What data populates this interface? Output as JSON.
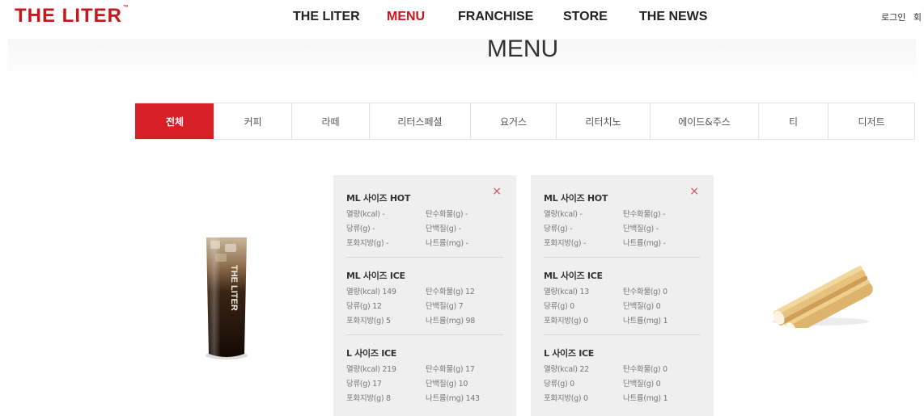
{
  "brand": {
    "logo": "THE LITER",
    "mark": "™"
  },
  "nav": {
    "items": [
      "THE LITER",
      "MENU",
      "FRANCHISE",
      "STORE",
      "THE NEWS"
    ],
    "active": "MENU"
  },
  "util": {
    "login": "로그인",
    "clipped": "회"
  },
  "page_title": "MENU",
  "tabs": {
    "items": [
      "전체",
      "커피",
      "라떼",
      "리터스페셜",
      "요거스",
      "리터치노",
      "에이드&주스",
      "티",
      "디저트"
    ],
    "active": "전체"
  },
  "panels": [
    {
      "close": "×",
      "sections": [
        {
          "title": "ML 사이즈 HOT",
          "rows": [
            [
              "열량(kcal) -",
              "탄수화물(g) -"
            ],
            [
              "당류(g) -",
              "단백질(g) -"
            ],
            [
              "포화지방(g) -",
              "나트륨(mg) -"
            ]
          ]
        },
        {
          "title": "ML 사이즈 ICE",
          "rows": [
            [
              "열량(kcal) 149",
              "탄수화물(g) 12"
            ],
            [
              "당류(g) 12",
              "단백질(g) 7"
            ],
            [
              "포화지방(g) 5",
              "나트륨(mg) 98"
            ]
          ]
        },
        {
          "title": "L 사이즈 ICE",
          "rows": [
            [
              "열량(kcal) 219",
              "탄수화물(g) 17"
            ],
            [
              "당류(g) 17",
              "단백질(g) 10"
            ],
            [
              "포화지방(g) 8",
              "나트륨(mg) 143"
            ]
          ]
        }
      ]
    },
    {
      "close": "×",
      "sections": [
        {
          "title": "ML 사이즈 HOT",
          "rows": [
            [
              "열량(kcal) -",
              "탄수화물(g) -"
            ],
            [
              "당류(g) -",
              "단백질(g) -"
            ],
            [
              "포화지방(g) -",
              "나트륨(mg) -"
            ]
          ]
        },
        {
          "title": "ML 사이즈 ICE",
          "rows": [
            [
              "열량(kcal) 13",
              "탄수화물(g) 0"
            ],
            [
              "당류(g) 0",
              "단백질(g) 0"
            ],
            [
              "포화지방(g) 0",
              "나트륨(mg) 1"
            ]
          ]
        },
        {
          "title": "L 사이즈 ICE",
          "rows": [
            [
              "열량(kcal) 22",
              "탄수화물(g) 0"
            ],
            [
              "당류(g) 0",
              "단백질(g) 0"
            ],
            [
              "포화지방(g) 0",
              "나트륨(mg) 1"
            ]
          ]
        }
      ]
    }
  ],
  "products": {
    "drink_cup_text": "THE LITER"
  },
  "colors": {
    "brand_red": "#c8161d",
    "tab_active": "#d61f26",
    "panel_bg": "#efefef",
    "close": "#e04a4a"
  }
}
